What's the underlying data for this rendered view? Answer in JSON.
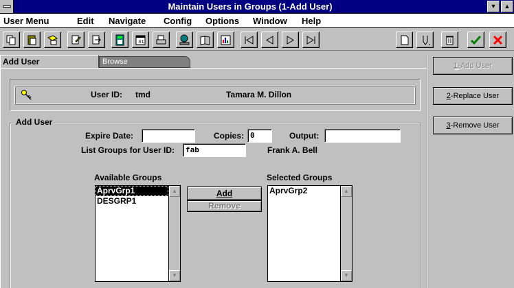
{
  "window": {
    "title": "Maintain Users in Groups (1-Add User)"
  },
  "menu": [
    {
      "label": "User Menu"
    },
    {
      "label": "Edit"
    },
    {
      "label": "Navigate"
    },
    {
      "label": "Config"
    },
    {
      "label": "Options"
    },
    {
      "label": "Window"
    },
    {
      "label": "Help"
    }
  ],
  "toolbar": {
    "icons": [
      "copy-icon",
      "paste-icon",
      "query-icon",
      "query-edit-icon",
      "query-exec-icon",
      "calculator-icon",
      "calendar-icon",
      "print-icon",
      "network-icon",
      "book-icon",
      "chart-icon",
      "first-record-icon",
      "prev-record-icon",
      "next-record-icon",
      "last-record-icon",
      "new-record-icon",
      "edit-record-icon",
      "delete-record-icon",
      "accept-icon",
      "cancel-icon"
    ]
  },
  "tabs": {
    "active": "Add User",
    "inactive": "Browse"
  },
  "header": {
    "user_id_label": "User ID:",
    "user_id": "tmd",
    "user_name": "Tamara M. Dillon"
  },
  "form": {
    "group_label": "Add User",
    "expire_label": "Expire Date:",
    "expire_value": "",
    "copies_label": "Copies:",
    "copies_value": "0",
    "output_label": "Output:",
    "output_value": "",
    "list_groups_label": "List Groups for User ID:",
    "list_groups_value": "fab",
    "list_groups_name": "Frank A. Bell",
    "available_label": "Available Groups",
    "selected_label": "Selected Groups",
    "available": [
      "AprvGrp1",
      "DESGRP1"
    ],
    "selected": [
      "AprvGrp2"
    ],
    "add_button": "Add",
    "remove_button": "Remove"
  },
  "side_buttons": [
    {
      "key": "1",
      "label": "-Add User"
    },
    {
      "key": "2",
      "label": "-Replace User"
    },
    {
      "key": "3",
      "label": "-Remove User"
    }
  ]
}
